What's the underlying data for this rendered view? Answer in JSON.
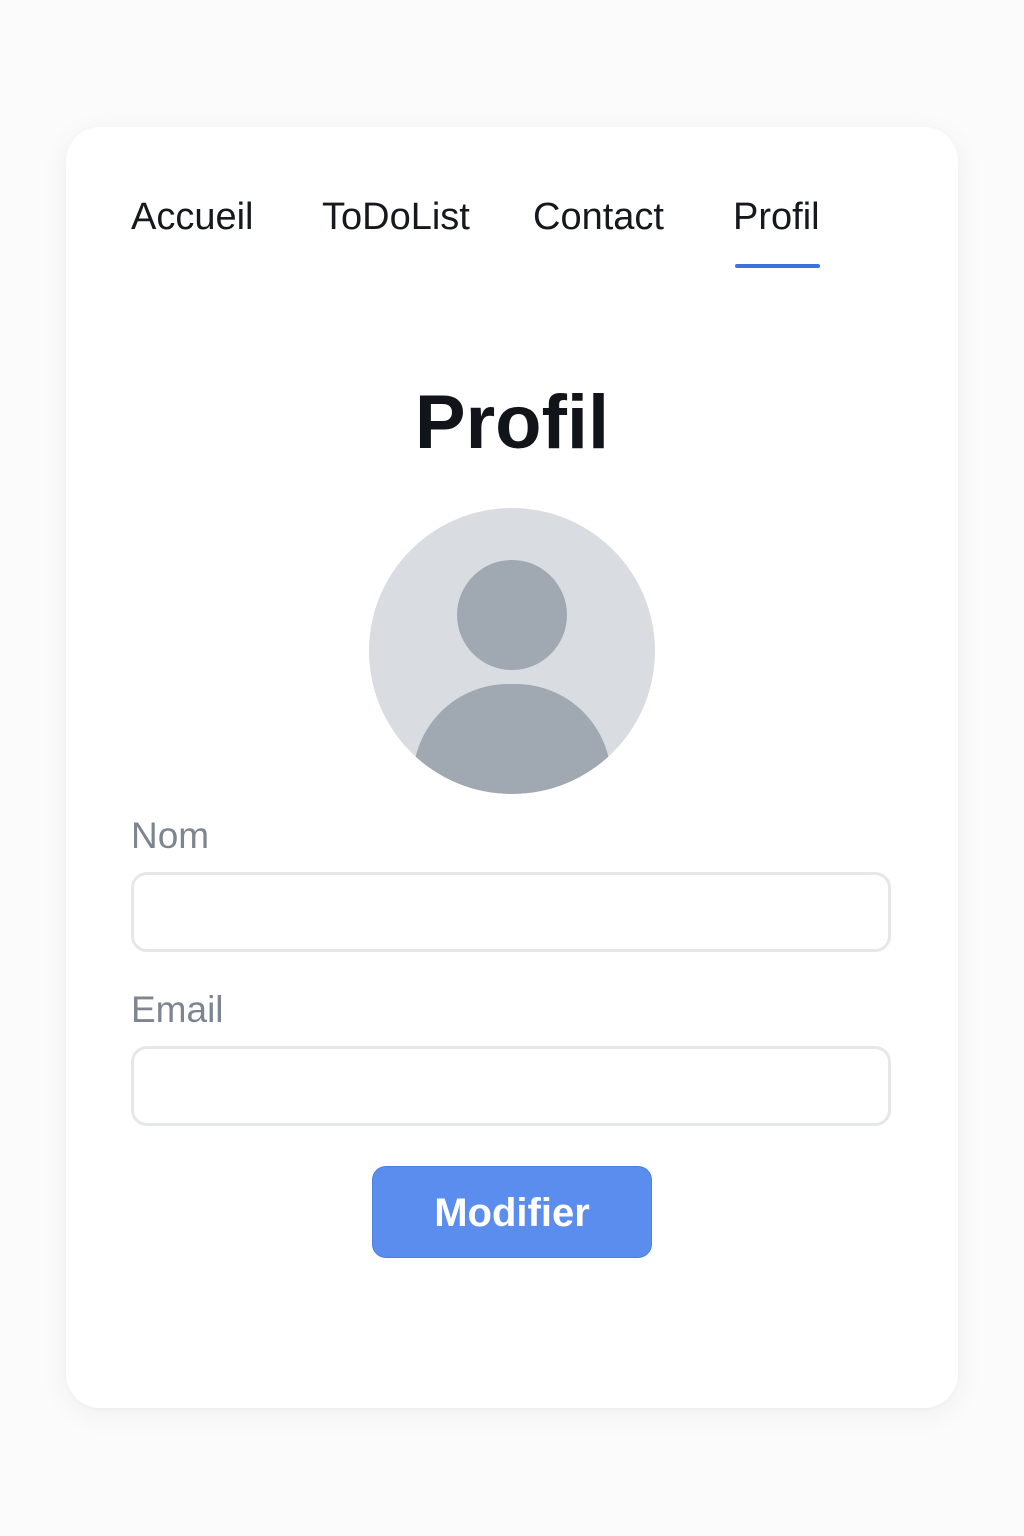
{
  "colors": {
    "accent": "#3d73dc",
    "button": "#5b8def",
    "background": "#fbfbfb",
    "card": "#ffffff"
  },
  "nav": {
    "items": [
      {
        "label": "Accueil",
        "active": false
      },
      {
        "label": "ToDoList",
        "active": false
      },
      {
        "label": "Contact",
        "active": false
      },
      {
        "label": "Profil",
        "active": true
      }
    ]
  },
  "page": {
    "title": "Profil"
  },
  "avatar": {
    "icon": "user-placeholder-icon"
  },
  "form": {
    "name_label": "Nom",
    "name_value": "",
    "email_label": "Email",
    "email_value": "",
    "submit_label": "Modifier"
  }
}
